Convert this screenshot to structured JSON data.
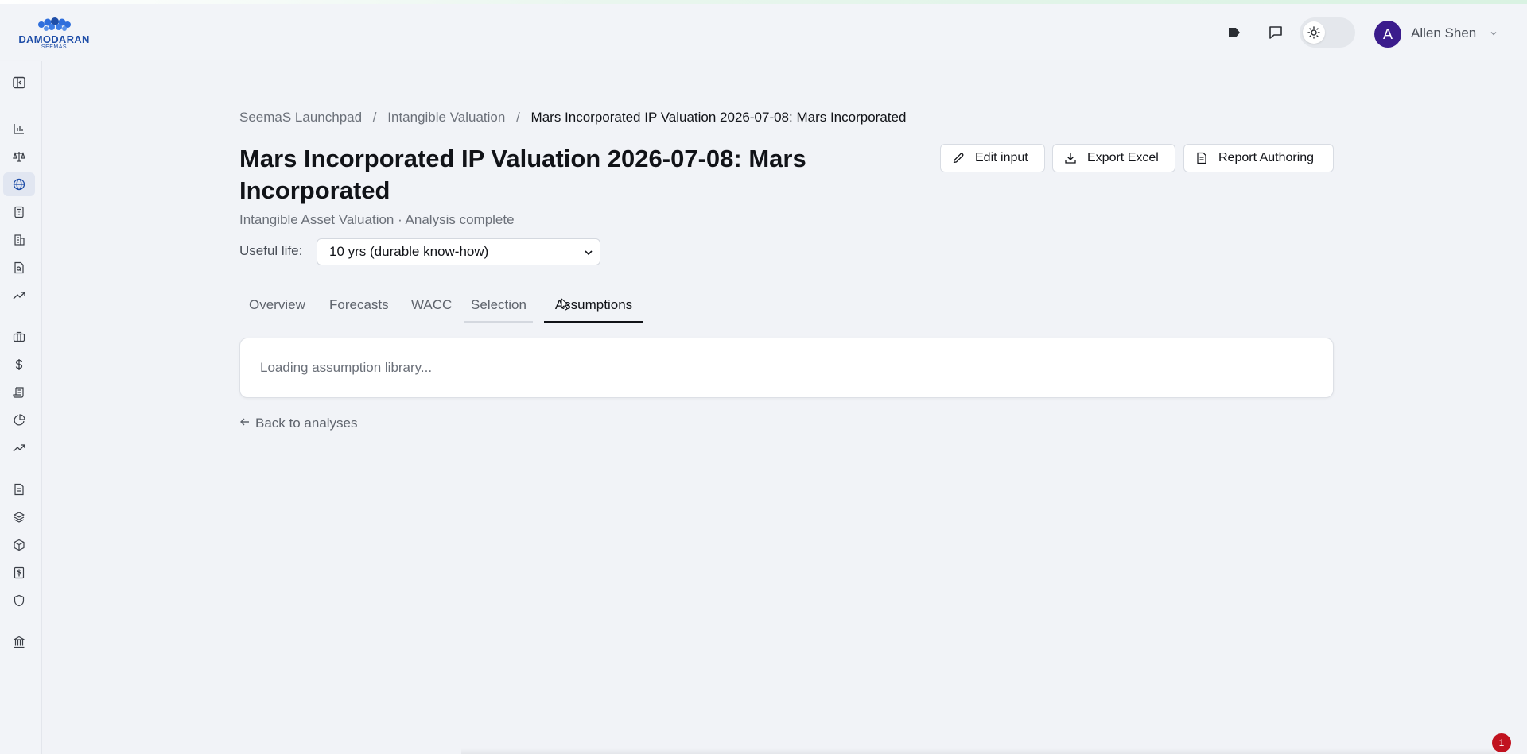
{
  "header": {
    "logo_text": "DAMODARAN",
    "logo_sub": "SEEMAS",
    "user_initial": "A",
    "user_name": "Allen Shen",
    "icons": [
      "tag-icon",
      "chat-icon",
      "sun-icon",
      "chevron-down-icon"
    ]
  },
  "sidebar": {
    "items": [
      {
        "name": "panel-toggle-icon",
        "active": false
      },
      {
        "name": "bar-chart-icon",
        "active": false
      },
      {
        "name": "scale-icon",
        "active": false
      },
      {
        "name": "globe-icon",
        "active": true
      },
      {
        "name": "calculator-icon",
        "active": false
      },
      {
        "name": "building-icon",
        "active": false
      },
      {
        "name": "file-search-icon",
        "active": false
      },
      {
        "name": "trending-up-icon",
        "active": false
      },
      {
        "name": "briefcase-icon",
        "active": false
      },
      {
        "name": "dollar-icon",
        "active": false
      },
      {
        "name": "scroll-icon",
        "active": false
      },
      {
        "name": "pie-chart-icon",
        "active": false
      },
      {
        "name": "trending-up-icon",
        "active": false
      },
      {
        "name": "document-icon",
        "active": false
      },
      {
        "name": "layers-icon",
        "active": false
      },
      {
        "name": "box-icon",
        "active": false
      },
      {
        "name": "receipt-dollar-icon",
        "active": false
      },
      {
        "name": "shield-icon",
        "active": false
      },
      {
        "name": "bank-icon",
        "active": false
      }
    ]
  },
  "breadcrumb": {
    "items": [
      "SeemaS Launchpad",
      "Intangible Valuation",
      "Mars Incorporated IP Valuation 2026-07-08: Mars Incorporated"
    ],
    "separator": "/"
  },
  "page": {
    "title": "Mars Incorporated IP Valuation 2026-07-08: Mars Incorporated",
    "subtitle": "Intangible Asset Valuation · Analysis complete",
    "useful_life_label": "Useful life:",
    "useful_life_value": "10 yrs (durable know-how)"
  },
  "actions": {
    "edit_input": "Edit input",
    "export_excel": "Export Excel",
    "report_authoring": "Report Authoring"
  },
  "tabs": {
    "items": [
      "Overview",
      "Forecasts",
      "WACC",
      "Selection",
      "Assumptions"
    ],
    "active": "Assumptions"
  },
  "content": {
    "loading_text": "Loading assumption library...",
    "back_link": "Back to analyses"
  },
  "notification": {
    "count": "1"
  },
  "colors": {
    "accent": "#1f4ea8",
    "avatar": "#3b1c8c",
    "badge": "#c1121f",
    "background": "#f1f3f7"
  }
}
